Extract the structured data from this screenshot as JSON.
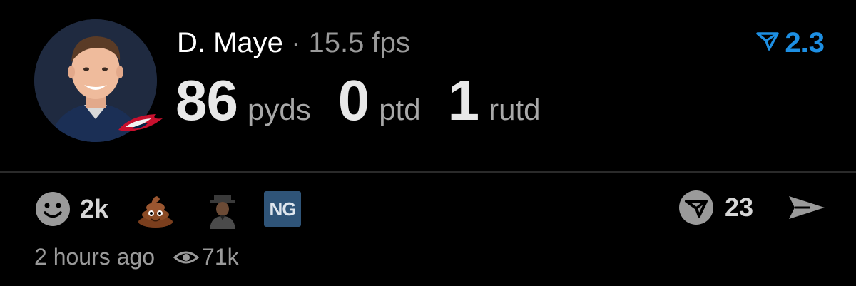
{
  "post": {
    "player_name": "D. Maye",
    "separator": "·",
    "fantasy_points": "15.5 fps",
    "score": "2.3",
    "stats": [
      {
        "value": "86",
        "unit": "pyds"
      },
      {
        "value": "0",
        "unit": "ptd"
      },
      {
        "value": "1",
        "unit": "rutd"
      }
    ]
  },
  "reactions": {
    "smiley_count": "2k",
    "ng_label": "NG"
  },
  "actions": {
    "comment_count": "23"
  },
  "meta": {
    "time_ago": "2 hours ago",
    "views": "71k"
  },
  "colors": {
    "accent": "#1d8fe3",
    "background": "#000000",
    "muted": "#9a9a9a"
  },
  "icons": [
    "player-avatar",
    "team-logo-icon",
    "score-icon",
    "smiley-icon",
    "poop-emoji-icon",
    "person-emoji-icon",
    "comment-icon",
    "send-icon",
    "eye-icon"
  ]
}
